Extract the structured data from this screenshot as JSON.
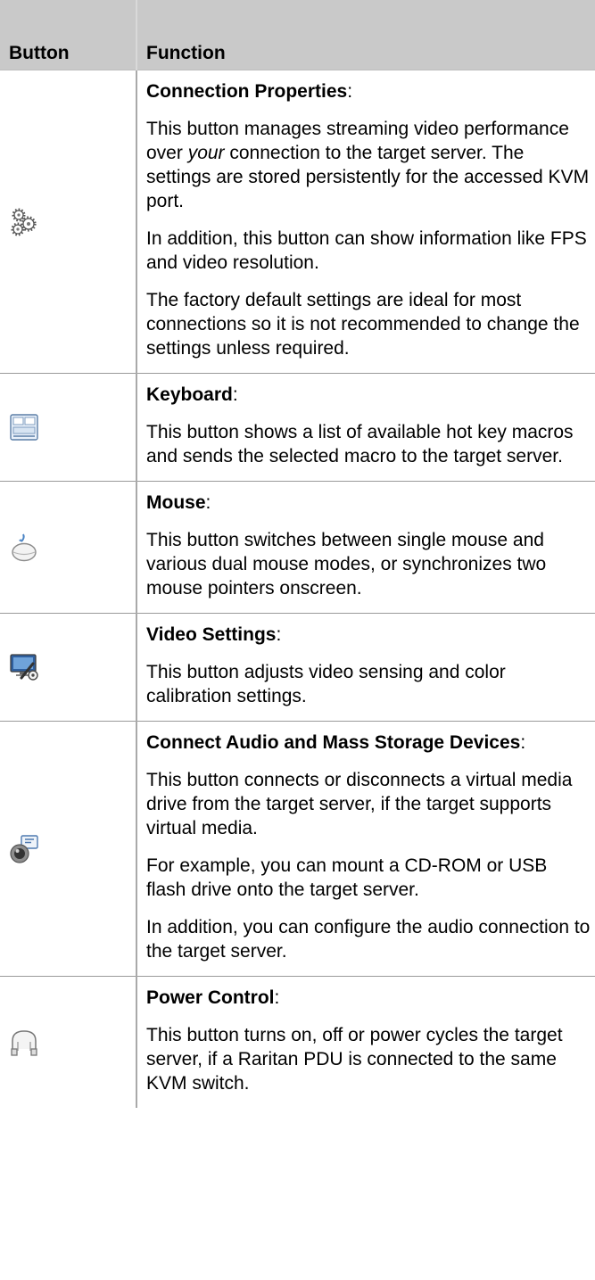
{
  "header": {
    "col_button": "Button",
    "col_function": "Function"
  },
  "rows": [
    {
      "icon": "gears-icon",
      "title": "Connection Properties",
      "paragraphs": [
        {
          "parts": [
            {
              "t": "This button manages streaming video performance over "
            },
            {
              "t": "your",
              "i": true
            },
            {
              "t": " connection to the target server. The settings are stored persistently for the accessed KVM port."
            }
          ]
        },
        {
          "parts": [
            {
              "t": "In addition, this button can show information like FPS and video resolution."
            }
          ]
        },
        {
          "parts": [
            {
              "t": "The factory default settings are ideal for most connections so it is not recommended to change the settings unless required."
            }
          ]
        }
      ]
    },
    {
      "icon": "keyboard-icon",
      "title": "Keyboard",
      "paragraphs": [
        {
          "parts": [
            {
              "t": "This button shows a list of available hot key macros and sends the selected macro to the target server."
            }
          ]
        }
      ]
    },
    {
      "icon": "mouse-icon",
      "title": "Mouse",
      "paragraphs": [
        {
          "parts": [
            {
              "t": "This button switches between single mouse and various dual mouse modes, or synchronizes two mouse pointers onscreen."
            }
          ]
        }
      ]
    },
    {
      "icon": "video-settings-icon",
      "title": "Video Settings",
      "paragraphs": [
        {
          "parts": [
            {
              "t": "This button adjusts video sensing and color calibration settings."
            }
          ]
        }
      ]
    },
    {
      "icon": "audio-storage-icon",
      "title": "Connect Audio and Mass Storage Devices",
      "paragraphs": [
        {
          "parts": [
            {
              "t": "This button connects or disconnects a virtual media drive from the target server, if the target supports virtual media."
            }
          ]
        },
        {
          "parts": [
            {
              "t": "For example, you can mount a CD-ROM or USB flash drive onto the target server."
            }
          ]
        },
        {
          "parts": [
            {
              "t": "In addition, you can configure the audio connection to the target server."
            }
          ]
        }
      ]
    },
    {
      "icon": "power-control-icon",
      "title": "Power Control",
      "paragraphs": [
        {
          "parts": [
            {
              "t": "This button turns on, off or power cycles the target server, if a Raritan PDU is connected to the same KVM switch."
            }
          ]
        }
      ]
    }
  ]
}
